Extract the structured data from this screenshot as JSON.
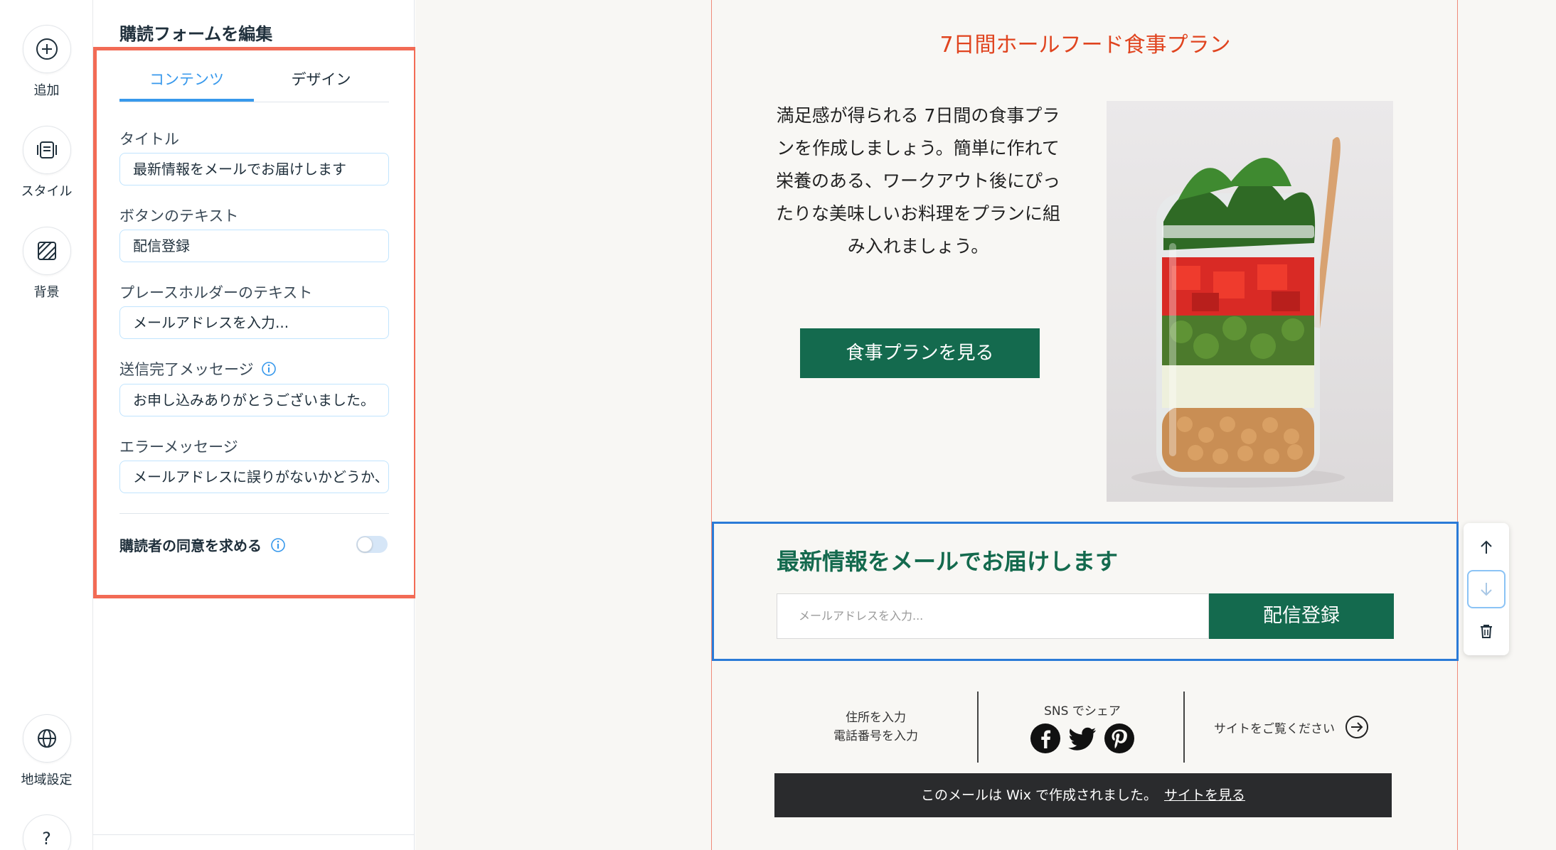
{
  "rail": {
    "add": "追加",
    "style": "スタイル",
    "background": "背景",
    "region": "地域設定",
    "help": "?"
  },
  "panel": {
    "title": "購読フォームを編集",
    "tabs": [
      "コンテンツ",
      "デザイン"
    ],
    "active_tab": "コンテンツ",
    "fields": {
      "title_label": "タイトル",
      "title_value": "最新情報をメールでお届けします",
      "button_label": "ボタンのテキスト",
      "button_value": "配信登録",
      "placeholder_label": "プレースホルダーのテキスト",
      "placeholder_value": "メールアドレスを入力...",
      "success_label": "送信完了メッセージ",
      "success_value": "お申し込みありがとうございました。",
      "error_label": "エラーメッセージ",
      "error_value": "メールアドレスに誤りがないかどうか、"
    },
    "consent_label": "購読者の同意を求める",
    "consent_enabled": false
  },
  "email": {
    "hero_title": "7日間ホールフード食事プラン",
    "hero_text": "満足感が得られる 7日間の食事プランを作成しましょう。簡単に作れて栄養のある、ワークアウト後にぴったりな美味しいお料理をプランに組み入れましょう。",
    "hero_button": "食事プランを見る",
    "subscribe_title": "最新情報をメールでお届けします",
    "subscribe_placeholder": "メールアドレスを入力...",
    "subscribe_button": "配信登録",
    "footer_address": "住所を入力",
    "footer_phone": "電話番号を入力",
    "footer_share": "SNS でシェア",
    "footer_site": "サイトをご覧ください",
    "wix_text": "このメールは Wix で作成されました。",
    "wix_link": "サイトを見る"
  },
  "icons": [
    "plus-icon",
    "style-icon",
    "background-icon",
    "globe-icon",
    "info-icon",
    "facebook-icon",
    "twitter-icon",
    "pinterest-icon",
    "arrow-right-circle-icon",
    "arrow-up-icon",
    "arrow-down-icon",
    "trash-icon"
  ],
  "colors": {
    "accent": "#3899ec",
    "highlight": "#f26b55",
    "brand_green": "#146a4e",
    "hero_title": "#e0441f",
    "selection": "#2b7bd7"
  }
}
